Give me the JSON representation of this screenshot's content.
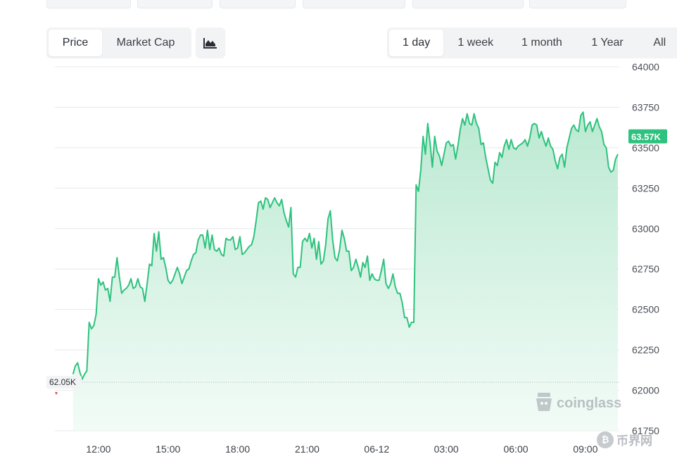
{
  "metric_tabs": [
    {
      "label": "Price",
      "active": true
    },
    {
      "label": "Market Cap",
      "active": false
    }
  ],
  "chart_type_icon": "area-chart-icon",
  "range_tabs": [
    {
      "label": "1 day",
      "active": true
    },
    {
      "label": "1 week",
      "active": false
    },
    {
      "label": "1 month",
      "active": false
    },
    {
      "label": "1 Year",
      "active": false
    },
    {
      "label": "All",
      "active": false
    }
  ],
  "watermark": {
    "icon": "coinglass-logo-icon",
    "text": "coinglass"
  },
  "site_mark": {
    "icon": "bitcoin-coin-icon",
    "text": "币界网"
  },
  "colors": {
    "line": "#2ec27e",
    "fill_top": "#b7e8cf",
    "fill_bottom": "#f1fbf6",
    "grid": "#e6e8eb",
    "current_badge": "#2ec27e"
  },
  "chart_data": {
    "type": "area",
    "title": "",
    "xlabel": "",
    "ylabel": "",
    "ylim": [
      61750,
      64000
    ],
    "y_ticks": [
      64000,
      63750,
      63500,
      63250,
      63000,
      62750,
      62500,
      62250,
      62000,
      61750
    ],
    "x_ticks": [
      {
        "label": "12:00",
        "t": 12
      },
      {
        "label": "15:00",
        "t": 15
      },
      {
        "label": "18:00",
        "t": 18
      },
      {
        "label": "21:00",
        "t": 21
      },
      {
        "label": "06-12",
        "t": 24
      },
      {
        "label": "03:00",
        "t": 27
      },
      {
        "label": "06:00",
        "t": 30
      },
      {
        "label": "09:00",
        "t": 33
      }
    ],
    "xlim": [
      10.5,
      34.4
    ],
    "start_label": "62.05K",
    "start_value": 62050,
    "current_label": "63.57K",
    "current_value": 63570,
    "grid": true,
    "series": [
      {
        "name": "",
        "points": [
          [
            10.9,
            62100
          ],
          [
            11.0,
            62150
          ],
          [
            11.1,
            62170
          ],
          [
            11.2,
            62110
          ],
          [
            11.3,
            62070
          ],
          [
            11.4,
            62100
          ],
          [
            11.5,
            62120
          ],
          [
            11.6,
            62420
          ],
          [
            11.7,
            62380
          ],
          [
            11.8,
            62400
          ],
          [
            11.9,
            62470
          ],
          [
            12.0,
            62690
          ],
          [
            12.1,
            62650
          ],
          [
            12.2,
            62670
          ],
          [
            12.3,
            62620
          ],
          [
            12.4,
            62630
          ],
          [
            12.5,
            62550
          ],
          [
            12.6,
            62700
          ],
          [
            12.7,
            62700
          ],
          [
            12.8,
            62820
          ],
          [
            12.9,
            62700
          ],
          [
            13.0,
            62600
          ],
          [
            13.1,
            62620
          ],
          [
            13.2,
            62630
          ],
          [
            13.3,
            62650
          ],
          [
            13.4,
            62690
          ],
          [
            13.5,
            62630
          ],
          [
            13.6,
            62640
          ],
          [
            13.7,
            62690
          ],
          [
            13.8,
            62640
          ],
          [
            13.9,
            62630
          ],
          [
            14.0,
            62550
          ],
          [
            14.1,
            62660
          ],
          [
            14.2,
            62780
          ],
          [
            14.3,
            62770
          ],
          [
            14.4,
            62970
          ],
          [
            14.5,
            62860
          ],
          [
            14.6,
            62980
          ],
          [
            14.7,
            62810
          ],
          [
            14.8,
            62820
          ],
          [
            14.9,
            62760
          ],
          [
            15.0,
            62680
          ],
          [
            15.1,
            62660
          ],
          [
            15.2,
            62680
          ],
          [
            15.3,
            62720
          ],
          [
            15.4,
            62760
          ],
          [
            15.5,
            62720
          ],
          [
            15.6,
            62660
          ],
          [
            15.7,
            62700
          ],
          [
            15.8,
            62740
          ],
          [
            15.9,
            62750
          ],
          [
            16.0,
            62800
          ],
          [
            16.1,
            62840
          ],
          [
            16.2,
            62850
          ],
          [
            16.3,
            62930
          ],
          [
            16.4,
            62960
          ],
          [
            16.5,
            62960
          ],
          [
            16.6,
            62880
          ],
          [
            16.7,
            62990
          ],
          [
            16.8,
            62870
          ],
          [
            16.9,
            62960
          ],
          [
            17.0,
            62870
          ],
          [
            17.1,
            62860
          ],
          [
            17.2,
            62880
          ],
          [
            17.3,
            62840
          ],
          [
            17.4,
            62830
          ],
          [
            17.5,
            62940
          ],
          [
            17.6,
            62930
          ],
          [
            17.7,
            62930
          ],
          [
            17.8,
            62950
          ],
          [
            17.9,
            62870
          ],
          [
            18.0,
            62880
          ],
          [
            18.1,
            62950
          ],
          [
            18.2,
            62840
          ],
          [
            18.3,
            62850
          ],
          [
            18.4,
            62870
          ],
          [
            18.5,
            62890
          ],
          [
            18.6,
            62900
          ],
          [
            18.7,
            62950
          ],
          [
            18.8,
            63050
          ],
          [
            18.9,
            63160
          ],
          [
            19.0,
            63170
          ],
          [
            19.1,
            63120
          ],
          [
            19.2,
            63190
          ],
          [
            19.3,
            63180
          ],
          [
            19.4,
            63130
          ],
          [
            19.5,
            63160
          ],
          [
            19.6,
            63190
          ],
          [
            19.7,
            63160
          ],
          [
            19.8,
            63140
          ],
          [
            19.9,
            63180
          ],
          [
            20.0,
            63100
          ],
          [
            20.1,
            63050
          ],
          [
            20.2,
            63010
          ],
          [
            20.3,
            63130
          ],
          [
            20.4,
            62720
          ],
          [
            20.5,
            62700
          ],
          [
            20.6,
            62760
          ],
          [
            20.7,
            62760
          ],
          [
            20.8,
            62920
          ],
          [
            20.9,
            62940
          ],
          [
            21.0,
            62920
          ],
          [
            21.1,
            62970
          ],
          [
            21.2,
            62880
          ],
          [
            21.3,
            62940
          ],
          [
            21.4,
            62810
          ],
          [
            21.5,
            62920
          ],
          [
            21.6,
            62780
          ],
          [
            21.7,
            62800
          ],
          [
            21.8,
            62900
          ],
          [
            21.9,
            63060
          ],
          [
            22.0,
            63110
          ],
          [
            22.1,
            62930
          ],
          [
            22.2,
            62820
          ],
          [
            22.3,
            62800
          ],
          [
            22.4,
            62870
          ],
          [
            22.5,
            62990
          ],
          [
            22.6,
            62940
          ],
          [
            22.7,
            62860
          ],
          [
            22.8,
            62860
          ],
          [
            22.9,
            62740
          ],
          [
            23.0,
            62760
          ],
          [
            23.1,
            62810
          ],
          [
            23.2,
            62760
          ],
          [
            23.3,
            62700
          ],
          [
            23.4,
            62790
          ],
          [
            23.5,
            62760
          ],
          [
            23.6,
            62830
          ],
          [
            23.7,
            62680
          ],
          [
            23.8,
            62720
          ],
          [
            23.9,
            62690
          ],
          [
            24.0,
            62680
          ],
          [
            24.1,
            62680
          ],
          [
            24.2,
            62740
          ],
          [
            24.3,
            62810
          ],
          [
            24.4,
            62660
          ],
          [
            24.5,
            62630
          ],
          [
            24.6,
            62660
          ],
          [
            24.7,
            62720
          ],
          [
            24.8,
            62640
          ],
          [
            24.9,
            62600
          ],
          [
            25.0,
            62600
          ],
          [
            25.1,
            62540
          ],
          [
            25.2,
            62450
          ],
          [
            25.3,
            62450
          ],
          [
            25.4,
            62390
          ],
          [
            25.5,
            62420
          ],
          [
            25.6,
            62420
          ],
          [
            25.7,
            63270
          ],
          [
            25.8,
            63230
          ],
          [
            25.9,
            63360
          ],
          [
            26.0,
            63570
          ],
          [
            26.1,
            63460
          ],
          [
            26.2,
            63650
          ],
          [
            26.3,
            63530
          ],
          [
            26.4,
            63380
          ],
          [
            26.5,
            63570
          ],
          [
            26.6,
            63480
          ],
          [
            26.7,
            63450
          ],
          [
            26.8,
            63390
          ],
          [
            26.9,
            63460
          ],
          [
            27.0,
            63530
          ],
          [
            27.1,
            63540
          ],
          [
            27.2,
            63510
          ],
          [
            27.3,
            63520
          ],
          [
            27.4,
            63430
          ],
          [
            27.5,
            63510
          ],
          [
            27.6,
            63610
          ],
          [
            27.7,
            63680
          ],
          [
            27.8,
            63640
          ],
          [
            27.9,
            63710
          ],
          [
            28.0,
            63650
          ],
          [
            28.1,
            63640
          ],
          [
            28.2,
            63710
          ],
          [
            28.3,
            63650
          ],
          [
            28.4,
            63620
          ],
          [
            28.5,
            63520
          ],
          [
            28.6,
            63530
          ],
          [
            28.7,
            63440
          ],
          [
            28.8,
            63370
          ],
          [
            28.9,
            63300
          ],
          [
            29.0,
            63280
          ],
          [
            29.1,
            63410
          ],
          [
            29.2,
            63390
          ],
          [
            29.3,
            63470
          ],
          [
            29.4,
            63440
          ],
          [
            29.5,
            63510
          ],
          [
            29.6,
            63550
          ],
          [
            29.7,
            63490
          ],
          [
            29.8,
            63550
          ],
          [
            29.9,
            63500
          ],
          [
            30.0,
            63490
          ],
          [
            30.1,
            63510
          ],
          [
            30.2,
            63520
          ],
          [
            30.3,
            63530
          ],
          [
            30.4,
            63550
          ],
          [
            30.5,
            63510
          ],
          [
            30.6,
            63560
          ],
          [
            30.7,
            63640
          ],
          [
            30.8,
            63650
          ],
          [
            30.9,
            63640
          ],
          [
            31.0,
            63560
          ],
          [
            31.1,
            63600
          ],
          [
            31.2,
            63550
          ],
          [
            31.3,
            63510
          ],
          [
            31.4,
            63560
          ],
          [
            31.5,
            63510
          ],
          [
            31.6,
            63490
          ],
          [
            31.7,
            63420
          ],
          [
            31.8,
            63370
          ],
          [
            31.9,
            63440
          ],
          [
            32.0,
            63460
          ],
          [
            32.1,
            63380
          ],
          [
            32.2,
            63500
          ],
          [
            32.3,
            63560
          ],
          [
            32.4,
            63620
          ],
          [
            32.5,
            63640
          ],
          [
            32.6,
            63610
          ],
          [
            32.7,
            63600
          ],
          [
            32.8,
            63700
          ],
          [
            32.9,
            63720
          ],
          [
            33.0,
            63600
          ],
          [
            33.1,
            63640
          ],
          [
            33.2,
            63660
          ],
          [
            33.3,
            63600
          ],
          [
            33.4,
            63640
          ],
          [
            33.5,
            63680
          ],
          [
            33.6,
            63630
          ],
          [
            33.7,
            63600
          ],
          [
            33.8,
            63520
          ],
          [
            33.9,
            63500
          ],
          [
            34.0,
            63380
          ],
          [
            34.1,
            63350
          ],
          [
            34.2,
            63360
          ],
          [
            34.3,
            63430
          ],
          [
            34.4,
            63460
          ]
        ]
      }
    ]
  }
}
